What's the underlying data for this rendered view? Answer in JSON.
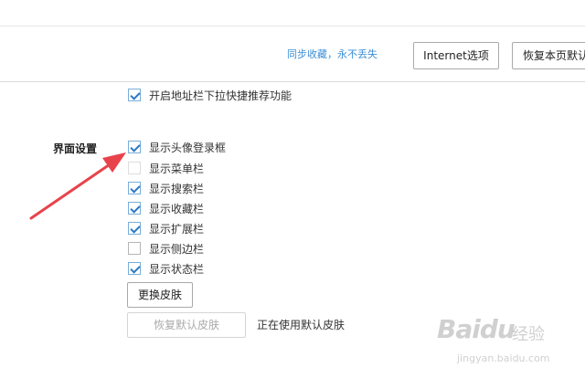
{
  "header": {
    "sync_link": "同步收藏，永不丢失",
    "internet_options_button": "Internet选项",
    "restore_page_button": "恢复本页默认"
  },
  "address_bar_option": {
    "label": "开启地址栏下拉快捷推荐功能",
    "checked": true
  },
  "interface_settings": {
    "section_label": "界面设置",
    "options": [
      {
        "label": "显示头像登录框",
        "checked": true
      },
      {
        "label": "显示菜单栏",
        "checked": false
      },
      {
        "label": "显示搜索栏",
        "checked": true
      },
      {
        "label": "显示收藏栏",
        "checked": true
      },
      {
        "label": "显示扩展栏",
        "checked": true
      },
      {
        "label": "显示侧边栏",
        "checked": false
      },
      {
        "label": "显示状态栏",
        "checked": true
      }
    ],
    "change_skin_button": "更换皮肤",
    "restore_skin_button": "恢复默认皮肤",
    "skin_status": "正在使用默认皮肤"
  },
  "watermark": {
    "brand": "Baidu",
    "brand_cn": "经验",
    "url": "jingyan.baidu.com"
  },
  "colors": {
    "link": "#3c8fd4",
    "check": "#2b78c5",
    "arrow": "#e8434b"
  }
}
